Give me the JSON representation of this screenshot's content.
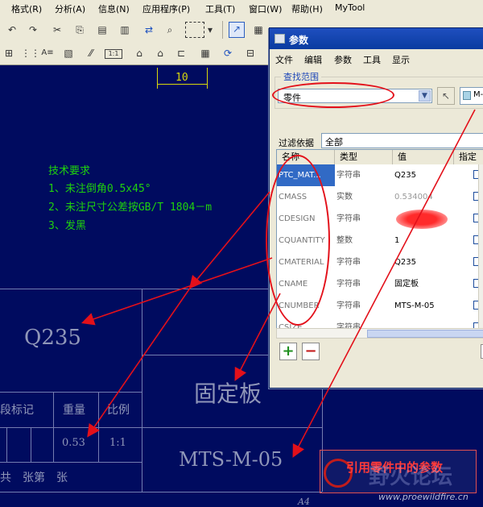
{
  "menubar": {
    "items": [
      "格式(R)",
      "分析(A)",
      "信息(N)",
      "应用程序(P)",
      "工具(T)",
      "窗口(W)",
      "帮助(H)",
      "MyTool"
    ]
  },
  "drawing": {
    "dimension": "10",
    "tech_req": {
      "title": "技术要求",
      "lines": [
        "1、未注倒角0.5x45°",
        "2、未注尺寸公差按GB/T 1804－m",
        "3、发黑"
      ]
    },
    "material": "Q235",
    "part_name": "固定板",
    "part_number": "MTS-M-05",
    "title_block": {
      "mark_label": "段标记",
      "weight_label": "重量",
      "scale_label": "比例",
      "weight": "0.53",
      "scale": "1:1",
      "sheet_text": "共　张第　张",
      "size": "A4"
    }
  },
  "dialog": {
    "title": "参数",
    "menu": [
      "文件",
      "编辑",
      "参数",
      "工具",
      "显示"
    ],
    "scope_label": "查找范围",
    "scope_value": "零件",
    "scope_target": "M-",
    "filter_label": "过滤依据",
    "filter_value": "全部",
    "columns": [
      "名称",
      "类型",
      "值",
      "指定"
    ],
    "rows": [
      {
        "name": "PTC_MAT...",
        "type": "字符串",
        "value": "Q235"
      },
      {
        "name": "CMASS",
        "type": "实数",
        "value": "0.534004"
      },
      {
        "name": "CDESIGN",
        "type": "字符串",
        "value": ""
      },
      {
        "name": "CQUANTITY",
        "type": "整数",
        "value": "1"
      },
      {
        "name": "CMATERIAL",
        "type": "字符串",
        "value": "Q235"
      },
      {
        "name": "CNAME",
        "type": "字符串",
        "value": "固定板"
      },
      {
        "name": "CNUMBER",
        "type": "字符串",
        "value": "MTS-M-05"
      },
      {
        "name": "CSIZE",
        "type": "字符串",
        "value": ""
      }
    ],
    "add_symbol": "+",
    "remove_symbol": "−"
  },
  "watermark": {
    "caption": "引用零件中的参数",
    "site": "野火论坛",
    "url": "www.proewildfire.cn"
  },
  "colors": {
    "canvas": "#000b5f",
    "cad_green": "#1fd10d",
    "annotation_red": "#e3101a",
    "chrome": "#ece9d8",
    "title_blue": "#0a3ba0"
  }
}
